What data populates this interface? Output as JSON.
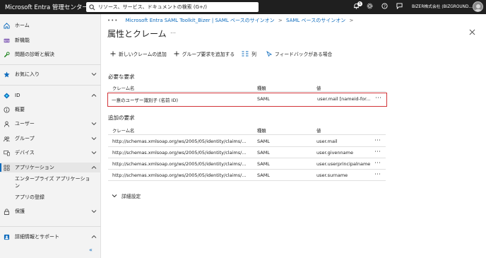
{
  "topbar": {
    "brand": "Microsoft Entra 管理センター",
    "search_placeholder": "リソース、サービス、ドキュメントの検索 (G+/)",
    "notification_count": "5",
    "account": "BIZER株式会社 (BIZGROUND...."
  },
  "sidebar": {
    "items": [
      {
        "label": "ホーム",
        "icon": "home-icon"
      },
      {
        "label": "新機能",
        "icon": "new-icon"
      },
      {
        "label": "問題の診断と解決",
        "icon": "wrench-icon"
      },
      {
        "label": "お気に入り",
        "icon": "star-icon"
      },
      {
        "label": "ID",
        "icon": "diamond-icon"
      },
      {
        "label": "概要",
        "icon": "info-icon"
      },
      {
        "label": "ユーザー",
        "icon": "user-icon"
      },
      {
        "label": "グループ",
        "icon": "group-icon"
      },
      {
        "label": "デバイス",
        "icon": "device-icon"
      },
      {
        "label": "アプリケーション",
        "icon": "apps-icon"
      },
      {
        "label": "エンタープライズ アプリケーショ",
        "icon": ""
      },
      {
        "label": "ン",
        "icon": ""
      },
      {
        "label": "アプリの登録",
        "icon": ""
      },
      {
        "label": "保護",
        "icon": "lock-icon"
      },
      {
        "label": "詳細情報とサポート",
        "icon": "help-icon"
      }
    ]
  },
  "breadcrumb": {
    "dots": "•••",
    "items": [
      "Microsoft Entra SAML Toolkit_Bizer | SAML ベースのサインオン",
      "SAML ベースのサインオン"
    ]
  },
  "page": {
    "title": "属性とクレーム",
    "more": "…"
  },
  "toolbar": {
    "add_claim": "新しいクレームの追加",
    "add_group_claim": "グループ要求を追加する",
    "columns": "列",
    "feedback": "フィードバックがある場合"
  },
  "required": {
    "title": "必要な要求",
    "headers": {
      "name": "クレーム名",
      "type": "種類",
      "value": "値"
    },
    "rows": [
      {
        "name": "一意のユーザー識別子 (名前 ID)",
        "type": "SAML",
        "value": "user.mail [nameid-for..."
      }
    ]
  },
  "additional": {
    "title": "追加の要求",
    "headers": {
      "name": "クレーム名",
      "type": "種類",
      "value": "値"
    },
    "rows": [
      {
        "name": "http://schemas.xmlsoap.org/ws/2005/05/identity/claims/...",
        "type": "SAML",
        "value": "user.mail"
      },
      {
        "name": "http://schemas.xmlsoap.org/ws/2005/05/identity/claims/...",
        "type": "SAML",
        "value": "user.givenname"
      },
      {
        "name": "http://schemas.xmlsoap.org/ws/2005/05/identity/claims/...",
        "type": "SAML",
        "value": "user.userprincipalname"
      },
      {
        "name": "http://schemas.xmlsoap.org/ws/2005/05/identity/claims/...",
        "type": "SAML",
        "value": "user.surname"
      }
    ]
  },
  "advanced": {
    "label": "詳細設定"
  },
  "colors": {
    "accent": "#0f6cbd",
    "highlight": "#d13438",
    "topbar": "#1f1f1f"
  }
}
